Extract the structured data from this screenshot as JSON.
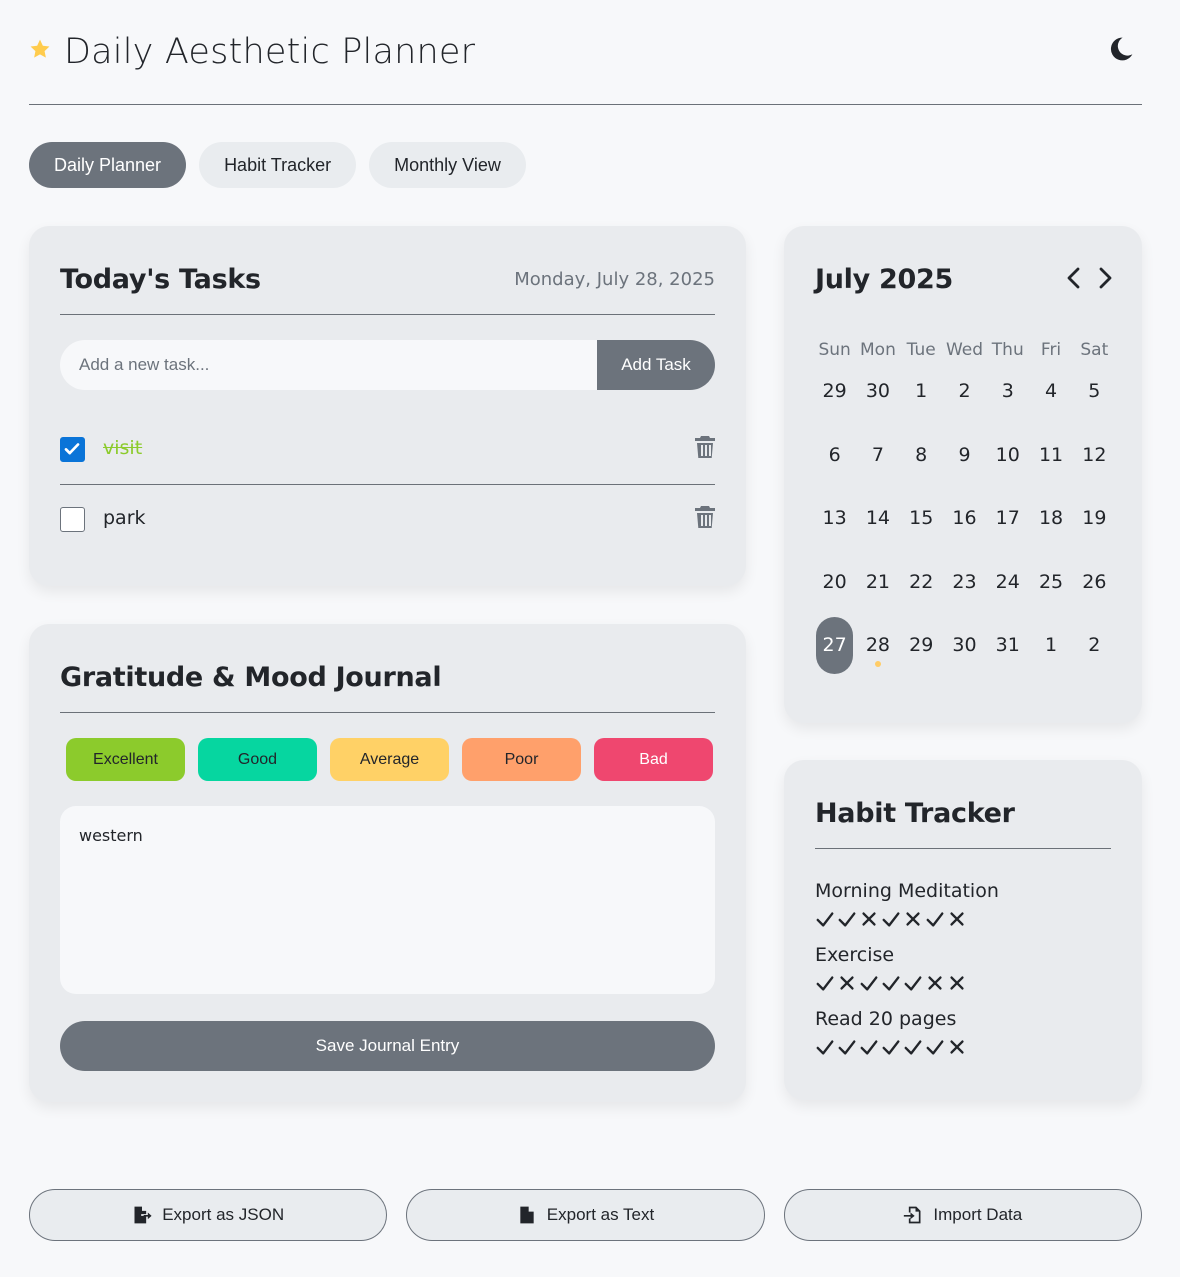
{
  "app": {
    "title": "Daily Aesthetic Planner",
    "theme_icon": "moon-icon",
    "accent_color": "#6c737c",
    "star_color": "#ffcc4d"
  },
  "tabs": [
    {
      "label": "Daily Planner",
      "active": true
    },
    {
      "label": "Habit Tracker",
      "active": false
    },
    {
      "label": "Monthly View",
      "active": false
    }
  ],
  "tasks": {
    "title": "Today's Tasks",
    "date": "Monday, July 28, 2025",
    "input_placeholder": "Add a new task...",
    "add_label": "Add Task",
    "items": [
      {
        "text": "visit",
        "done": true
      },
      {
        "text": "park",
        "done": false
      }
    ]
  },
  "journal": {
    "title": "Gratitude & Mood Journal",
    "moods": [
      {
        "label": "Excellent",
        "color": "#8ccb2c",
        "text_color": "#22252a"
      },
      {
        "label": "Good",
        "color": "#06d6a0",
        "text_color": "#22252a"
      },
      {
        "label": "Average",
        "color": "#ffd166",
        "text_color": "#22252a"
      },
      {
        "label": "Poor",
        "color": "#ffa06b",
        "text_color": "#22252a"
      },
      {
        "label": "Bad",
        "color": "#ef476f",
        "text_color": "#ffffff"
      }
    ],
    "entry_text": "western",
    "save_label": "Save Journal Entry"
  },
  "calendar": {
    "title": "July 2025",
    "weekdays": [
      "Sun",
      "Mon",
      "Tue",
      "Wed",
      "Thu",
      "Fri",
      "Sat"
    ],
    "weeks": [
      [
        "29",
        "30",
        "1",
        "2",
        "3",
        "4",
        "5"
      ],
      [
        "6",
        "7",
        "8",
        "9",
        "10",
        "11",
        "12"
      ],
      [
        "13",
        "14",
        "15",
        "16",
        "17",
        "18",
        "19"
      ],
      [
        "20",
        "21",
        "22",
        "23",
        "24",
        "25",
        "26"
      ],
      [
        "27",
        "28",
        "29",
        "30",
        "31",
        "1",
        "2"
      ]
    ],
    "today": "27",
    "has_entry": "28"
  },
  "habits": {
    "title": "Habit Tracker",
    "items": [
      {
        "name": "Morning Meditation",
        "marks": [
          "check",
          "check",
          "cross",
          "check",
          "cross",
          "check",
          "cross"
        ]
      },
      {
        "name": "Exercise",
        "marks": [
          "check",
          "cross",
          "check",
          "check",
          "check",
          "cross",
          "cross"
        ]
      },
      {
        "name": "Read 20 pages",
        "marks": [
          "check",
          "check",
          "check",
          "check",
          "check",
          "check",
          "cross"
        ]
      }
    ]
  },
  "footer": {
    "export_json_label": "Export as JSON",
    "export_text_label": "Export as Text",
    "import_label": "Import Data"
  }
}
